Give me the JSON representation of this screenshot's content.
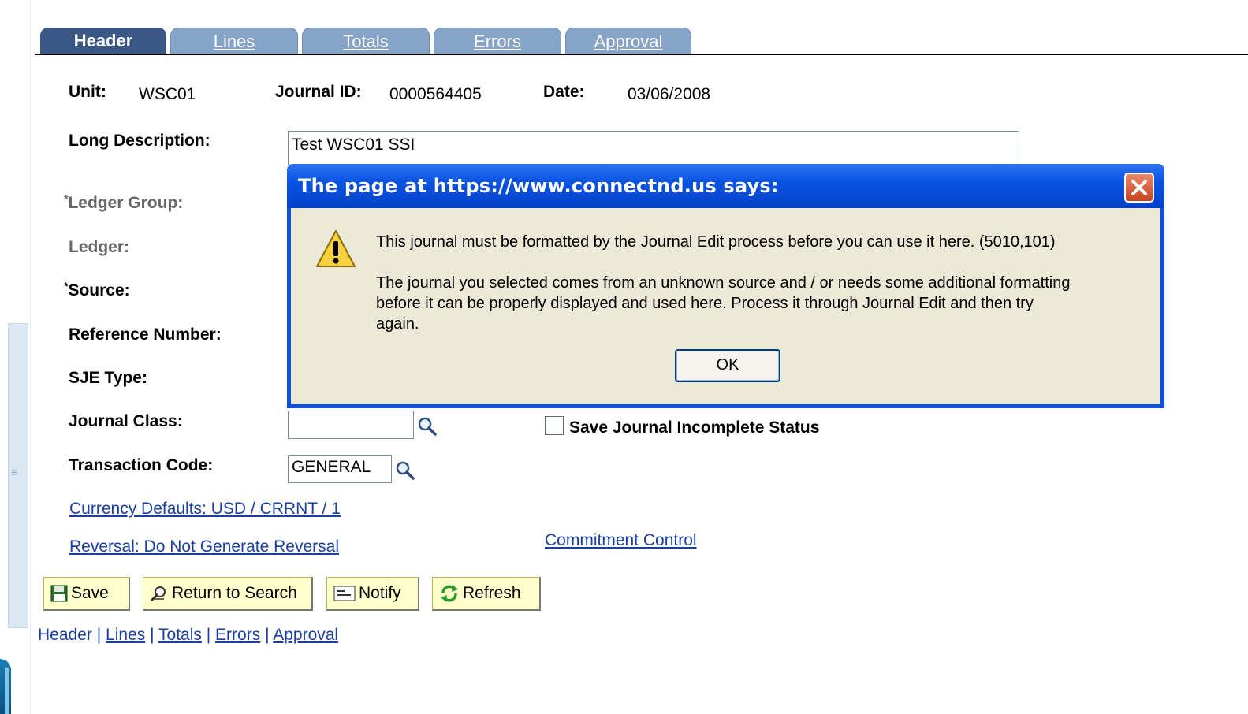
{
  "tabs": [
    {
      "label": "Header"
    },
    {
      "label": "Lines"
    },
    {
      "label": "Totals"
    },
    {
      "label": "Errors"
    },
    {
      "label": "Approval"
    }
  ],
  "header_fields": {
    "unit_label": "Unit:",
    "unit_value": "WSC01",
    "journal_id_label": "Journal ID:",
    "journal_id_value": "0000564405",
    "date_label": "Date:",
    "date_value": "03/06/2008",
    "long_description_label": "Long Description:",
    "long_description_value": "Test WSC01 SSI",
    "ledger_group_label": "Ledger Group:",
    "ledger_label": "Ledger:",
    "source_label": "Source:",
    "reference_number_label": "Reference Number:",
    "sje_type_label": "SJE Type:",
    "journal_class_label": "Journal Class:",
    "journal_class_value": "",
    "transaction_code_label": "Transaction Code:",
    "transaction_code_value": "GENERAL",
    "required_mark": "*"
  },
  "checkbox": {
    "save_incomplete_label": "Save Journal Incomplete Status",
    "checked": false
  },
  "links": {
    "currency_defaults": "Currency Defaults: USD / CRRNT / 1",
    "reversal": "Reversal: Do Not Generate Reversal",
    "commitment_control": "Commitment Control"
  },
  "buttons": {
    "save": "Save",
    "return_to_search": "Return to Search",
    "notify": "Notify",
    "refresh": "Refresh"
  },
  "bottom_nav": {
    "header": "Header",
    "lines": "Lines",
    "totals": "Totals",
    "errors": "Errors",
    "approval": "Approval",
    "separator": "|"
  },
  "dialog": {
    "title": "The page at https://www.connectnd.us says:",
    "message_line1": "This journal must be formatted by the Journal Edit process before you can use it here. (5010,101)",
    "message_line2a": "The journal you selected comes from an unknown source and / or needs some additional formatting",
    "message_line2b": "before it can be properly displayed and used here.  Process it through Journal Edit and then try",
    "message_line2c": "again.",
    "ok_label": "OK"
  },
  "icons": {
    "warning": "warning-icon",
    "close": "close-icon",
    "lookup": "magnifier-icon",
    "save": "floppy-disk-icon",
    "return": "return-search-icon",
    "notify": "notify-icon",
    "refresh": "refresh-icon"
  },
  "colors": {
    "tab_active": "#3b5786",
    "tab_inactive": "#86a3c8",
    "dialog_title": "#0a54e2",
    "dialog_body": "#ece9d8",
    "button_bg": "#ffffcc",
    "link": "#1a3fa3"
  }
}
